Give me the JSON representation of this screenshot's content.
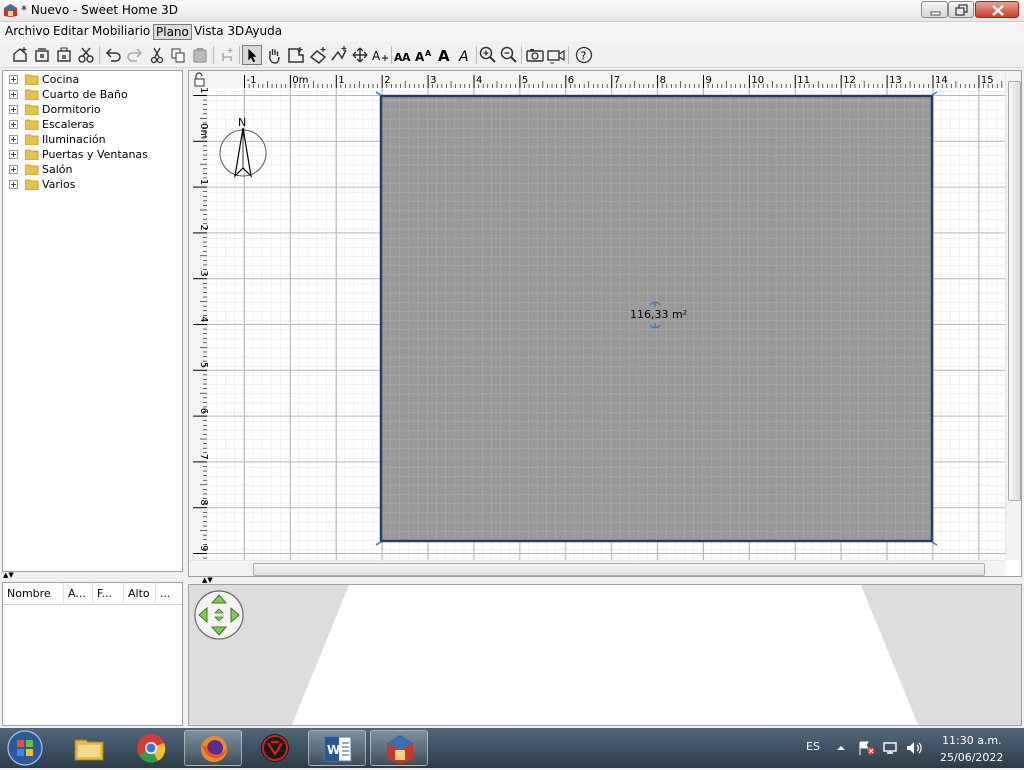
{
  "window": {
    "title": "* Nuevo - Sweet Home 3D"
  },
  "menu": {
    "items": [
      "Archivo",
      "Editar",
      "Mobiliario",
      "Plano",
      "Vista 3D",
      "Ayuda"
    ],
    "active": "Plano"
  },
  "toolbar": {
    "buttons": [
      "new-home-icon",
      "new-home-from-example-icon",
      "open-icon",
      "cut-icon",
      "undo-icon",
      "redo-icon",
      "cut-icon",
      "copy-icon",
      "paste-icon",
      "add-furniture-icon",
      "select-icon",
      "pan-icon",
      "create-rooms-icon",
      "create-walls-icon",
      "create-polylines-icon",
      "create-dimensions-icon",
      "add-text-icon",
      "increase-text-size-icon",
      "decrease-text-size-icon",
      "bold-icon",
      "italic-icon",
      "zoom-in-icon",
      "zoom-out-icon",
      "create-photo-icon",
      "create-video-icon",
      "help-icon"
    ]
  },
  "catalog": {
    "categories": [
      "Cocina",
      "Cuarto de Baño",
      "Dormitorio",
      "Escaleras",
      "Iluminación",
      "Puertas y Ventanas",
      "Salón",
      "Varios"
    ]
  },
  "furniture_table": {
    "columns": [
      "Nombre",
      "A...",
      "F...",
      "Alto",
      "..."
    ]
  },
  "plan": {
    "ruler_x": [
      "-1",
      "0m",
      "1",
      "2",
      "3",
      "4",
      "5",
      "6",
      "7",
      "8",
      "9",
      "10",
      "11",
      "12",
      "13",
      "14",
      "15"
    ],
    "ruler_y": [
      "-1",
      "0m",
      "1",
      "2",
      "3",
      "4",
      "5",
      "6",
      "7",
      "8",
      "9"
    ],
    "compass_label": "N",
    "room_area": "116,33 m²",
    "room_color": "#999999",
    "wall_color": "#1f3f6e"
  },
  "taskbar": {
    "apps": [
      "start-orb",
      "file-explorer-icon",
      "chrome-icon",
      "firefox-icon",
      "app-icon",
      "word-icon",
      "sweet-home-3d-icon"
    ],
    "language": "ES",
    "time": "11:30 a.m.",
    "date": "25/06/2022"
  }
}
